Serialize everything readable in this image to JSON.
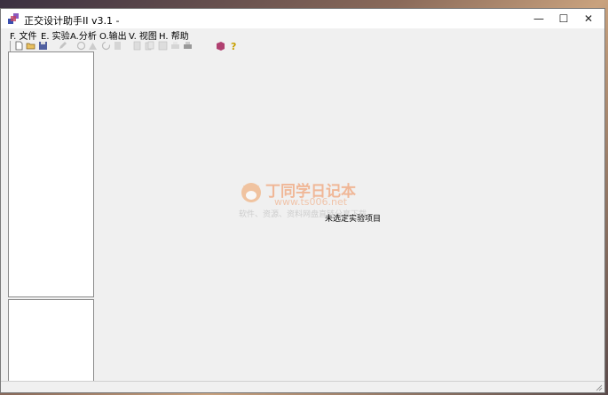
{
  "window": {
    "title": "正交设计助手II v3.1 -",
    "minimize_glyph": "—",
    "maximize_glyph": "☐",
    "close_glyph": "✕"
  },
  "menu": [
    {
      "key": "F",
      "label": ". 文件"
    },
    {
      "key": "E",
      "label": ". 实验"
    },
    {
      "key": "A",
      "label": ".分析"
    },
    {
      "key": "O",
      "label": ".输出"
    },
    {
      "key": "V",
      "label": ". 视图"
    },
    {
      "key": "H",
      "label": ". 帮助"
    }
  ],
  "toolbar_icons": [
    "new-file-icon",
    "open-folder-icon",
    "save-icon",
    "edit-icon",
    "recycle-icon",
    "triangle-icon",
    "refresh-icon",
    "calculate-icon",
    "document-icon",
    "copy-icon",
    "preview-icon",
    "print-icon",
    "book-icon",
    "help-icon"
  ],
  "main": {
    "status_message": "未选定实验项目"
  },
  "watermark": {
    "title": "丁同学日记本",
    "url": "www.ts006.net",
    "subtitle": "软件、资源、资料网盘直链分享下载"
  }
}
